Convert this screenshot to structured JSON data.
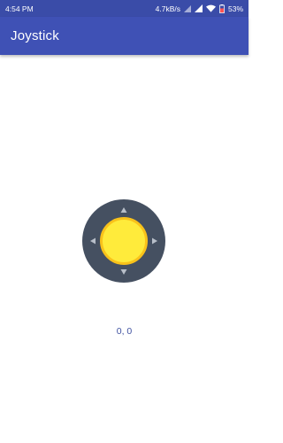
{
  "status_bar": {
    "time": "4:54 PM",
    "network_speed": "4.7kB/s",
    "battery_percent": "53%",
    "icons": [
      "signal-icon",
      "signal-icon",
      "wifi-icon",
      "battery-icon"
    ]
  },
  "app_bar": {
    "title": "Joystick"
  },
  "joystick": {
    "base_color": "#455061",
    "knob_color": "#ffeb3b",
    "knob_border_color": "#f9c21a",
    "arrow_color": "#b8bfc9",
    "arrows": [
      "arrow-up-icon",
      "arrow-right-icon",
      "arrow-down-icon",
      "arrow-left-icon"
    ]
  },
  "coordinates": {
    "text": "0, 0"
  },
  "colors": {
    "primary": "#3f51b5",
    "primary_dark": "#3a4ca8",
    "coords_text": "#3f51a0"
  }
}
